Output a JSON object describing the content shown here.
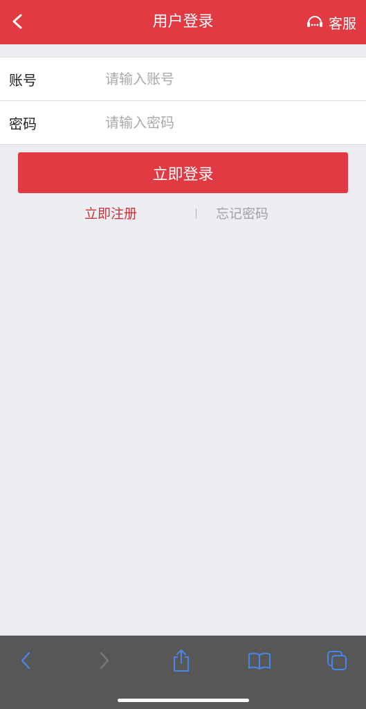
{
  "header": {
    "title": "用户登录",
    "service_label": "客服"
  },
  "form": {
    "account_label": "账号",
    "account_placeholder": "请输入账号",
    "account_value": "",
    "password_label": "密码",
    "password_placeholder": "请输入密码",
    "password_value": ""
  },
  "actions": {
    "login_label": "立即登录",
    "register_label": "立即注册",
    "forgot_label": "忘记密码"
  },
  "toolbar": {
    "icons": [
      "back-icon",
      "forward-icon",
      "share-icon",
      "bookmarks-icon",
      "tabs-icon"
    ]
  },
  "colors": {
    "brand": "#e23a43",
    "background": "#eeedf2",
    "toolbar": "#575757",
    "toolbar_icon": "#4a86e8"
  }
}
